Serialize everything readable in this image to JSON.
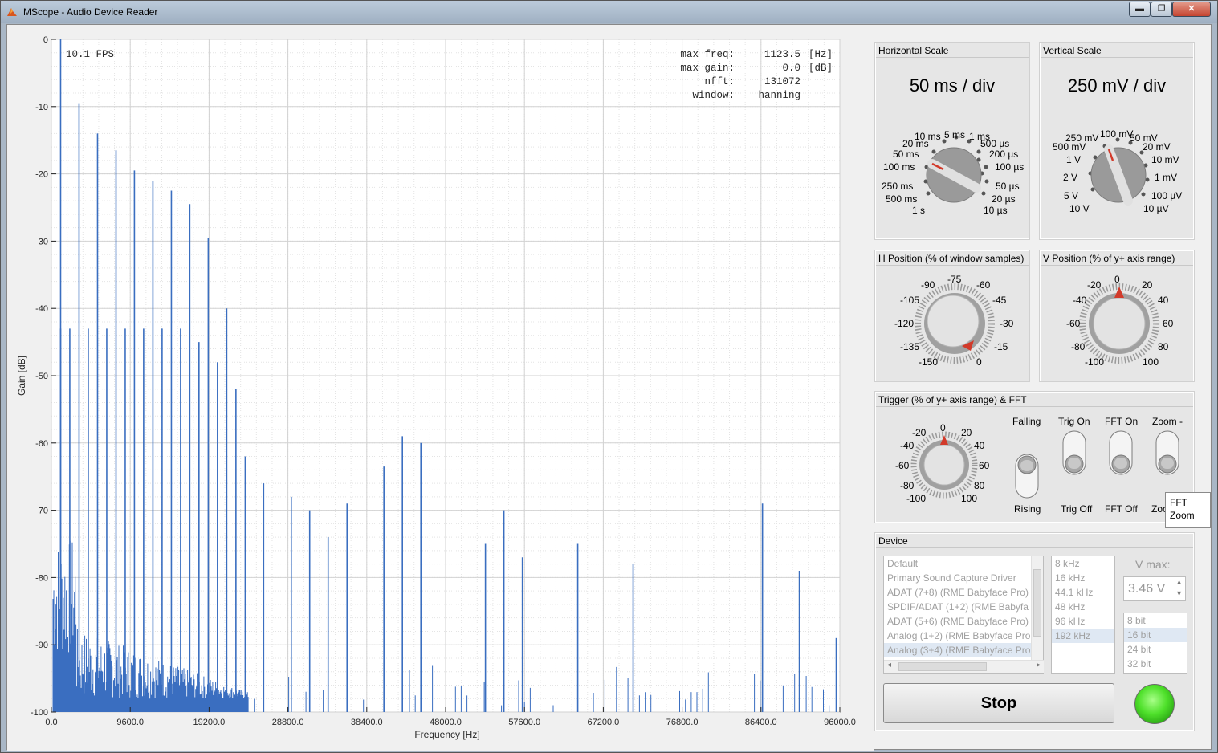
{
  "window": {
    "title": "MScope - Audio Device Reader",
    "min_glyph": "▬",
    "max_glyph": "❐",
    "close_glyph": "✕"
  },
  "plot": {
    "fps_text": "10.1 FPS",
    "info": [
      {
        "key": "max freq:",
        "value": "1123.5",
        "unit": "[Hz]"
      },
      {
        "key": "max gain:",
        "value": "0.0",
        "unit": "[dB]"
      },
      {
        "key": "nfft:",
        "value": "131072",
        "unit": ""
      },
      {
        "key": "window:",
        "value": "hanning",
        "unit": ""
      }
    ],
    "xlabel": "Frequency [Hz]",
    "ylabel": "Gain [dB]",
    "line_color": "#3a6ec0"
  },
  "chart_data": {
    "type": "line",
    "title": "",
    "xlabel": "Frequency [Hz]",
    "ylabel": "Gain [dB]",
    "xlim": [
      0,
      96000
    ],
    "ylim": [
      -100,
      0
    ],
    "grid": true,
    "xticks": [
      "0.0",
      "9600.0",
      "19200.0",
      "28800.0",
      "38400.0",
      "48000.0",
      "57600.0",
      "67200.0",
      "76800.0",
      "86400.0",
      "96000.0"
    ],
    "yticks": [
      "0",
      "-10",
      "-20",
      "-30",
      "-40",
      "-50",
      "-60",
      "-70",
      "-80",
      "-90",
      "-100"
    ],
    "peaks": [
      {
        "x": 1123.5,
        "y": 0
      },
      {
        "x": 3370,
        "y": -9.5
      },
      {
        "x": 5620,
        "y": -14
      },
      {
        "x": 7870,
        "y": -16.5
      },
      {
        "x": 10110,
        "y": -19.5
      },
      {
        "x": 12360,
        "y": -21
      },
      {
        "x": 14610,
        "y": -22.5
      },
      {
        "x": 16850,
        "y": -24.5
      },
      {
        "x": 19100,
        "y": -29.5
      },
      {
        "x": 21350,
        "y": -40
      },
      {
        "x": 1123,
        "y": -43
      },
      {
        "x": 2240,
        "y": -43
      },
      {
        "x": 4490,
        "y": -43
      },
      {
        "x": 6740,
        "y": -43
      },
      {
        "x": 8990,
        "y": -43
      },
      {
        "x": 11230,
        "y": -43
      },
      {
        "x": 13480,
        "y": -43
      },
      {
        "x": 15730,
        "y": -43
      },
      {
        "x": 17970,
        "y": -45
      },
      {
        "x": 20220,
        "y": -48
      },
      {
        "x": 22470,
        "y": -52
      },
      {
        "x": 23600,
        "y": -62
      },
      {
        "x": 25840,
        "y": -66
      },
      {
        "x": 29210,
        "y": -68
      },
      {
        "x": 31450,
        "y": -70
      },
      {
        "x": 33700,
        "y": -74
      },
      {
        "x": 36000,
        "y": -69
      },
      {
        "x": 40490,
        "y": -63.5
      },
      {
        "x": 42740,
        "y": -59
      },
      {
        "x": 44990,
        "y": -60
      },
      {
        "x": 52850,
        "y": -75
      },
      {
        "x": 55100,
        "y": -70
      },
      {
        "x": 57350,
        "y": -77
      },
      {
        "x": 64090,
        "y": -75
      },
      {
        "x": 70830,
        "y": -78
      },
      {
        "x": 86580,
        "y": -69
      },
      {
        "x": 91070,
        "y": -79
      },
      {
        "x": 95560,
        "y": -89
      }
    ],
    "noise_floor_db": -100
  },
  "horizontal_scale": {
    "title": "Horizontal Scale",
    "value": "50 ms / div",
    "labels": [
      "10 ms",
      "5 ms",
      "1 ms",
      "20 ms",
      "500 µs",
      "50 ms",
      "200 µs",
      "100 ms",
      "100 µs",
      "250 ms",
      "50 µs",
      "500 ms",
      "20 µs",
      "1 s",
      "10 µs"
    ]
  },
  "vertical_scale": {
    "title": "Vertical Scale",
    "value": "250 mV / div",
    "labels": [
      "250 mV",
      "100 mV",
      "50 mV",
      "500 mV",
      "20 mV",
      "1 V",
      "10 mV",
      "2 V",
      "1 mV",
      "5 V",
      "100 µV",
      "10 V",
      "10 µV"
    ]
  },
  "h_position": {
    "title": "H Position (% of window samples)",
    "labels": [
      "-75",
      "-90",
      "-60",
      "-105",
      "-45",
      "-120",
      "-30",
      "-135",
      "-15",
      "-150",
      "0"
    ]
  },
  "v_position": {
    "title": "V Position (% of y+ axis range)",
    "labels": [
      "0",
      "-20",
      "20",
      "-40",
      "40",
      "-60",
      "60",
      "-80",
      "80",
      "-100",
      "100"
    ]
  },
  "trigger": {
    "title": "Trigger (% of y+ axis range) & FFT",
    "knob_labels": [
      "0",
      "-20",
      "20",
      "-40",
      "40",
      "-60",
      "60",
      "-80",
      "80",
      "-100",
      "100"
    ],
    "switches": [
      {
        "top": "Falling",
        "bottom": "Rising"
      },
      {
        "top": "Trig On",
        "bottom": "Trig Off"
      },
      {
        "top": "FFT On",
        "bottom": "FFT Off"
      },
      {
        "top": "Zoom -",
        "bottom": "Zoo"
      }
    ],
    "tooltip_line1": "FFT",
    "tooltip_line2": "Zoom"
  },
  "device": {
    "title": "Device",
    "devices": [
      "Default",
      "Primary Sound Capture Driver",
      "ADAT (7+8) (RME Babyface Pro)",
      "SPDIF/ADAT (1+2) (RME Babyfa",
      "ADAT (5+6) (RME Babyface Pro)",
      "Analog (1+2) (RME Babyface Pro",
      "Analog (3+4) (RME Babyface Pro"
    ],
    "selected_device": 6,
    "rates": [
      "8 kHz",
      "16 kHz",
      "44.1 kHz",
      "48 kHz",
      "96 kHz",
      "192 kHz"
    ],
    "selected_rate": 5,
    "vmax_label": "V max:",
    "vmax_value": "3.46 V",
    "bits": [
      "8 bit",
      "16 bit",
      "24 bit",
      "32 bit"
    ],
    "selected_bit": 1,
    "stop_label": "Stop",
    "led_color": "#4ee02a"
  }
}
